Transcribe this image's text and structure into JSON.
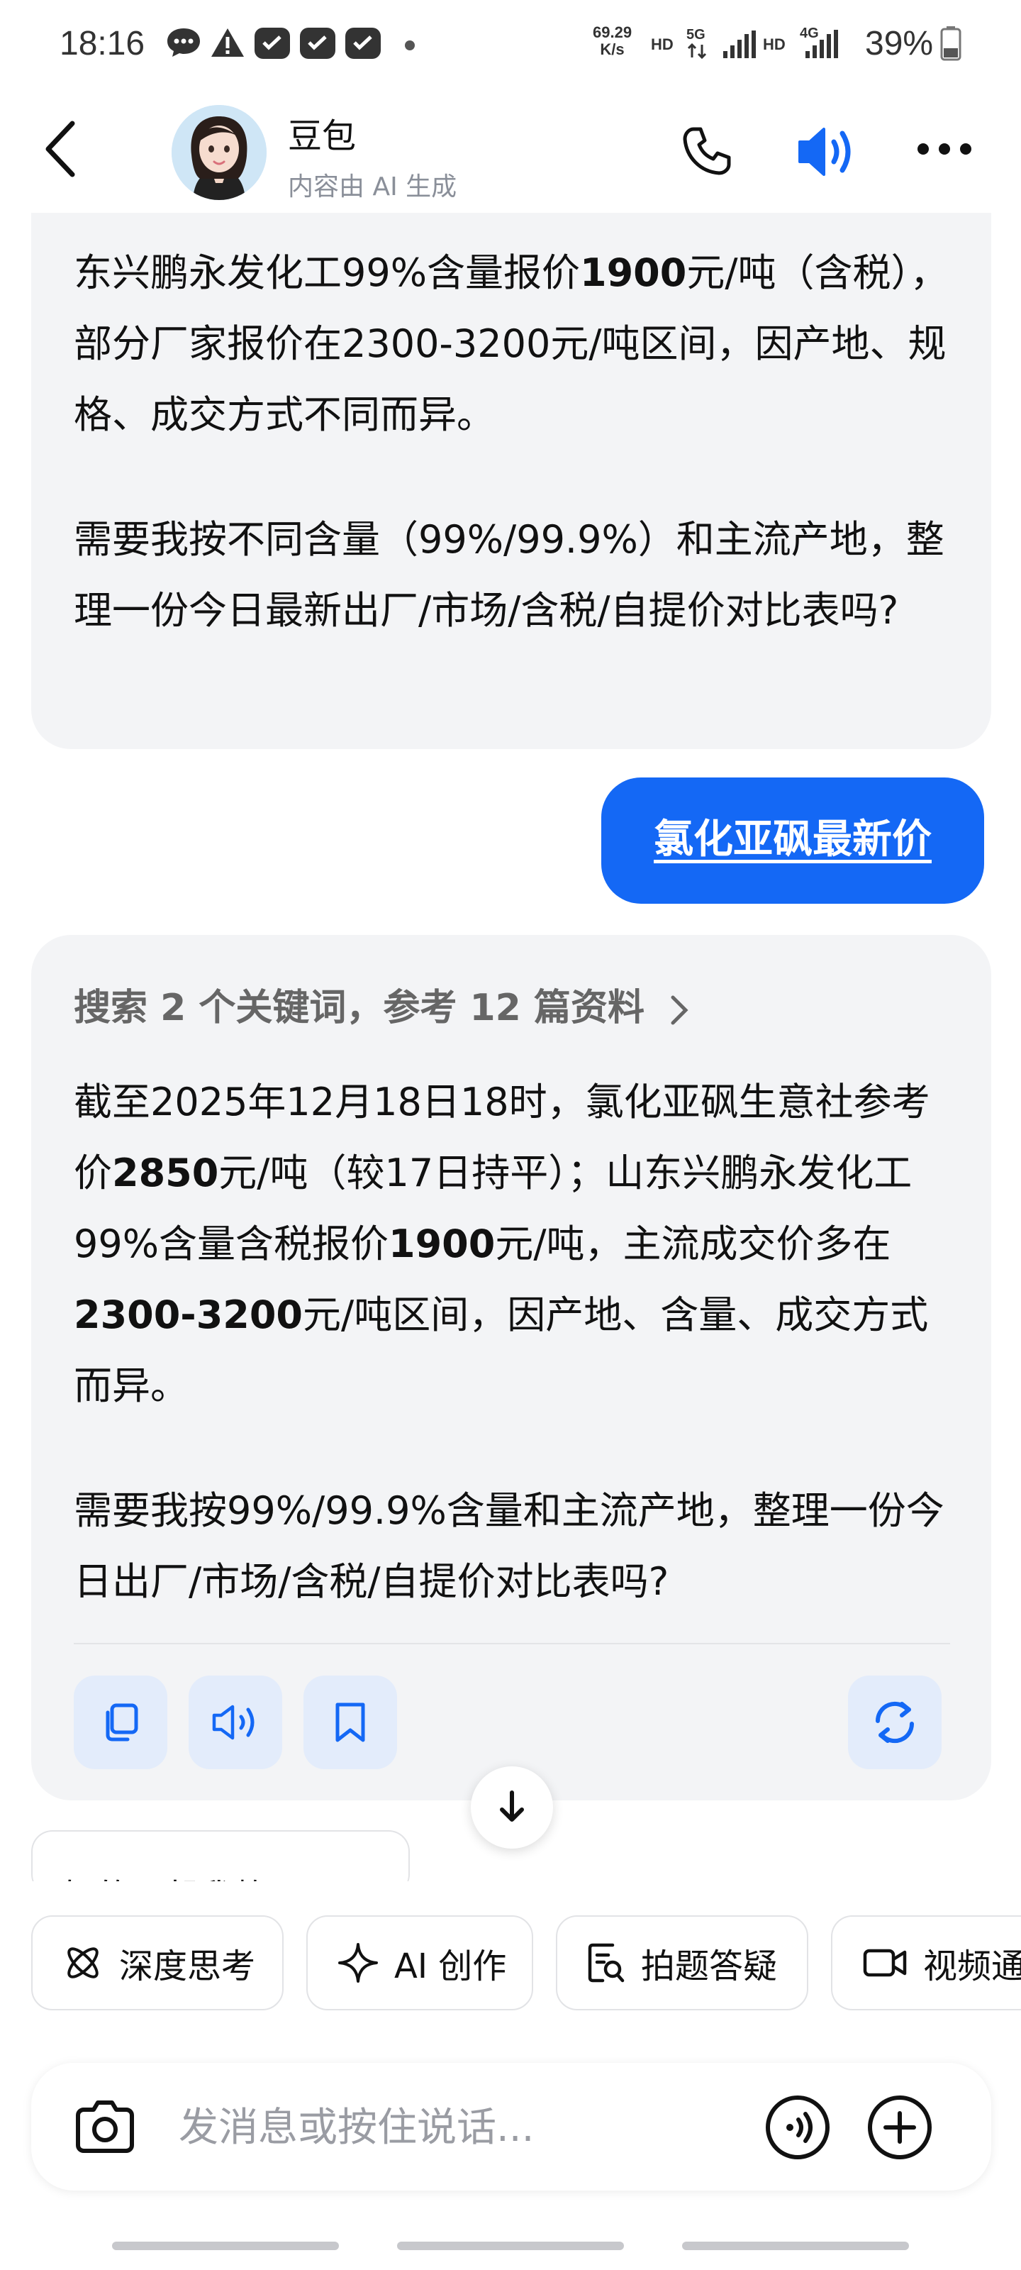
{
  "status_bar": {
    "time": "18:16",
    "net_speed_value": "69.29",
    "net_speed_unit": "K/s",
    "hd1": "HD",
    "net1": "5G",
    "hd2": "HD",
    "net2": "4G",
    "battery": "39%"
  },
  "header": {
    "name": "豆包",
    "subtitle": "内容由 AI 生成",
    "icons": [
      "back-icon",
      "phone-icon",
      "speaker-icon",
      "more-icon"
    ]
  },
  "messages": {
    "top_para1_parts": [
      "东兴鹏永发化工99%含量报价",
      "1900",
      "元/吨（含税），部分厂家报价在",
      "2300-3200",
      "元/吨区间，因产地、规格、成交方式不同而异。"
    ],
    "top_para2": "需要我按不同含量（99%/99.9%）和主流产地，整理一份今日最新出厂/市场/含税/自提价对比表吗?",
    "user": "氯化亚砜最新价",
    "search_ref": "搜索 2 个关键词，参考 12 篇资料",
    "ai_para1_parts": [
      "截至2025年12月18日18时，氯化亚砜生意社参考价",
      "2850",
      "元/吨（较17日持平）；山东兴鹏永发化工99%含量含税报价",
      "1900",
      "元/吨，主流成交价多在",
      "2300-3200",
      "元/吨区间，因产地、含量、成交方式而异。"
    ],
    "ai_para2": "需要我按99%/99.9%含量和主流产地，整理一份今日出厂/市场/含税/自提价对比表吗?"
  },
  "suggestion": "好的，帮我整理下吧",
  "quick_actions": [
    {
      "label": "深度思考",
      "icon": "atom-icon"
    },
    {
      "label": "AI 创作",
      "icon": "sparkle-icon"
    },
    {
      "label": "拍题答疑",
      "icon": "photo-search-icon"
    },
    {
      "label": "视频通",
      "icon": "video-icon"
    }
  ],
  "input": {
    "placeholder": "发消息或按住说话..."
  },
  "colors": {
    "accent": "#1468f5",
    "bubble_bg": "#f3f4f6"
  }
}
